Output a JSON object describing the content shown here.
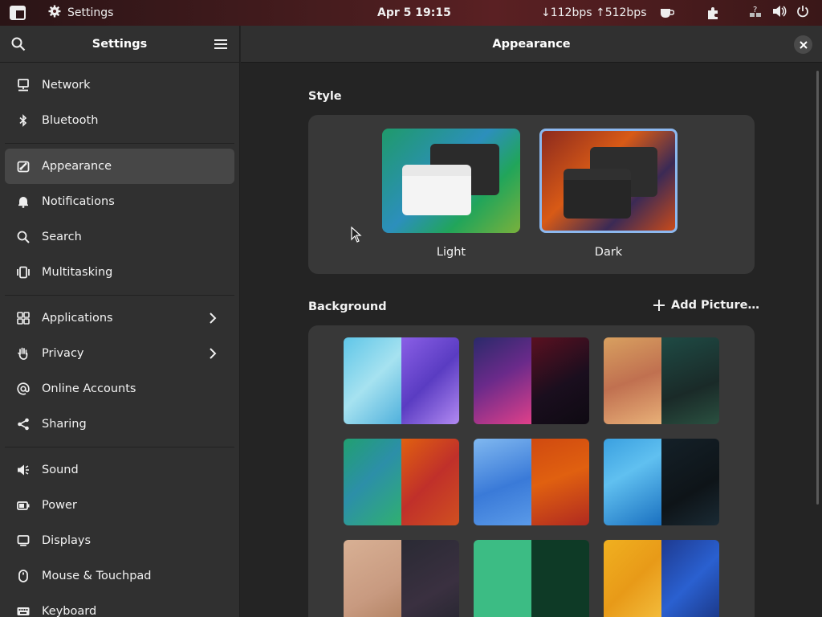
{
  "topbar": {
    "app_name": "Settings",
    "clock": "Apr 5  19:15",
    "network": "↓112bps ↑512bps",
    "icons": [
      "apps-icon",
      "gear-icon",
      "coffee-icon",
      "extension-icon",
      "network-question-icon",
      "volume-icon",
      "power-icon"
    ]
  },
  "sidebar": {
    "title": "Settings",
    "items": [
      {
        "label": "Network",
        "icon": "network-icon"
      },
      {
        "label": "Bluetooth",
        "icon": "bluetooth-icon"
      },
      {
        "label": "Appearance",
        "icon": "appearance-icon",
        "active": true
      },
      {
        "label": "Notifications",
        "icon": "bell-icon"
      },
      {
        "label": "Search",
        "icon": "search-icon"
      },
      {
        "label": "Multitasking",
        "icon": "multitasking-icon"
      },
      {
        "label": "Applications",
        "icon": "grid-icon",
        "chevron": true
      },
      {
        "label": "Privacy",
        "icon": "hand-icon",
        "chevron": true
      },
      {
        "label": "Online Accounts",
        "icon": "at-icon"
      },
      {
        "label": "Sharing",
        "icon": "share-icon"
      },
      {
        "label": "Sound",
        "icon": "speaker-icon"
      },
      {
        "label": "Power",
        "icon": "power-icon"
      },
      {
        "label": "Displays",
        "icon": "display-icon"
      },
      {
        "label": "Mouse & Touchpad",
        "icon": "mouse-icon"
      },
      {
        "label": "Keyboard",
        "icon": "keyboard-icon"
      }
    ]
  },
  "main": {
    "title": "Appearance",
    "style": {
      "heading": "Style",
      "options": [
        {
          "label": "Light",
          "selected": false
        },
        {
          "label": "Dark",
          "selected": true
        }
      ]
    },
    "background": {
      "heading": "Background",
      "add_label": "Add Picture…"
    }
  },
  "colors": {
    "accent": "#8cb8ef",
    "sidebar_bg": "#303030",
    "main_bg": "#242424",
    "panel_bg": "#383838"
  }
}
